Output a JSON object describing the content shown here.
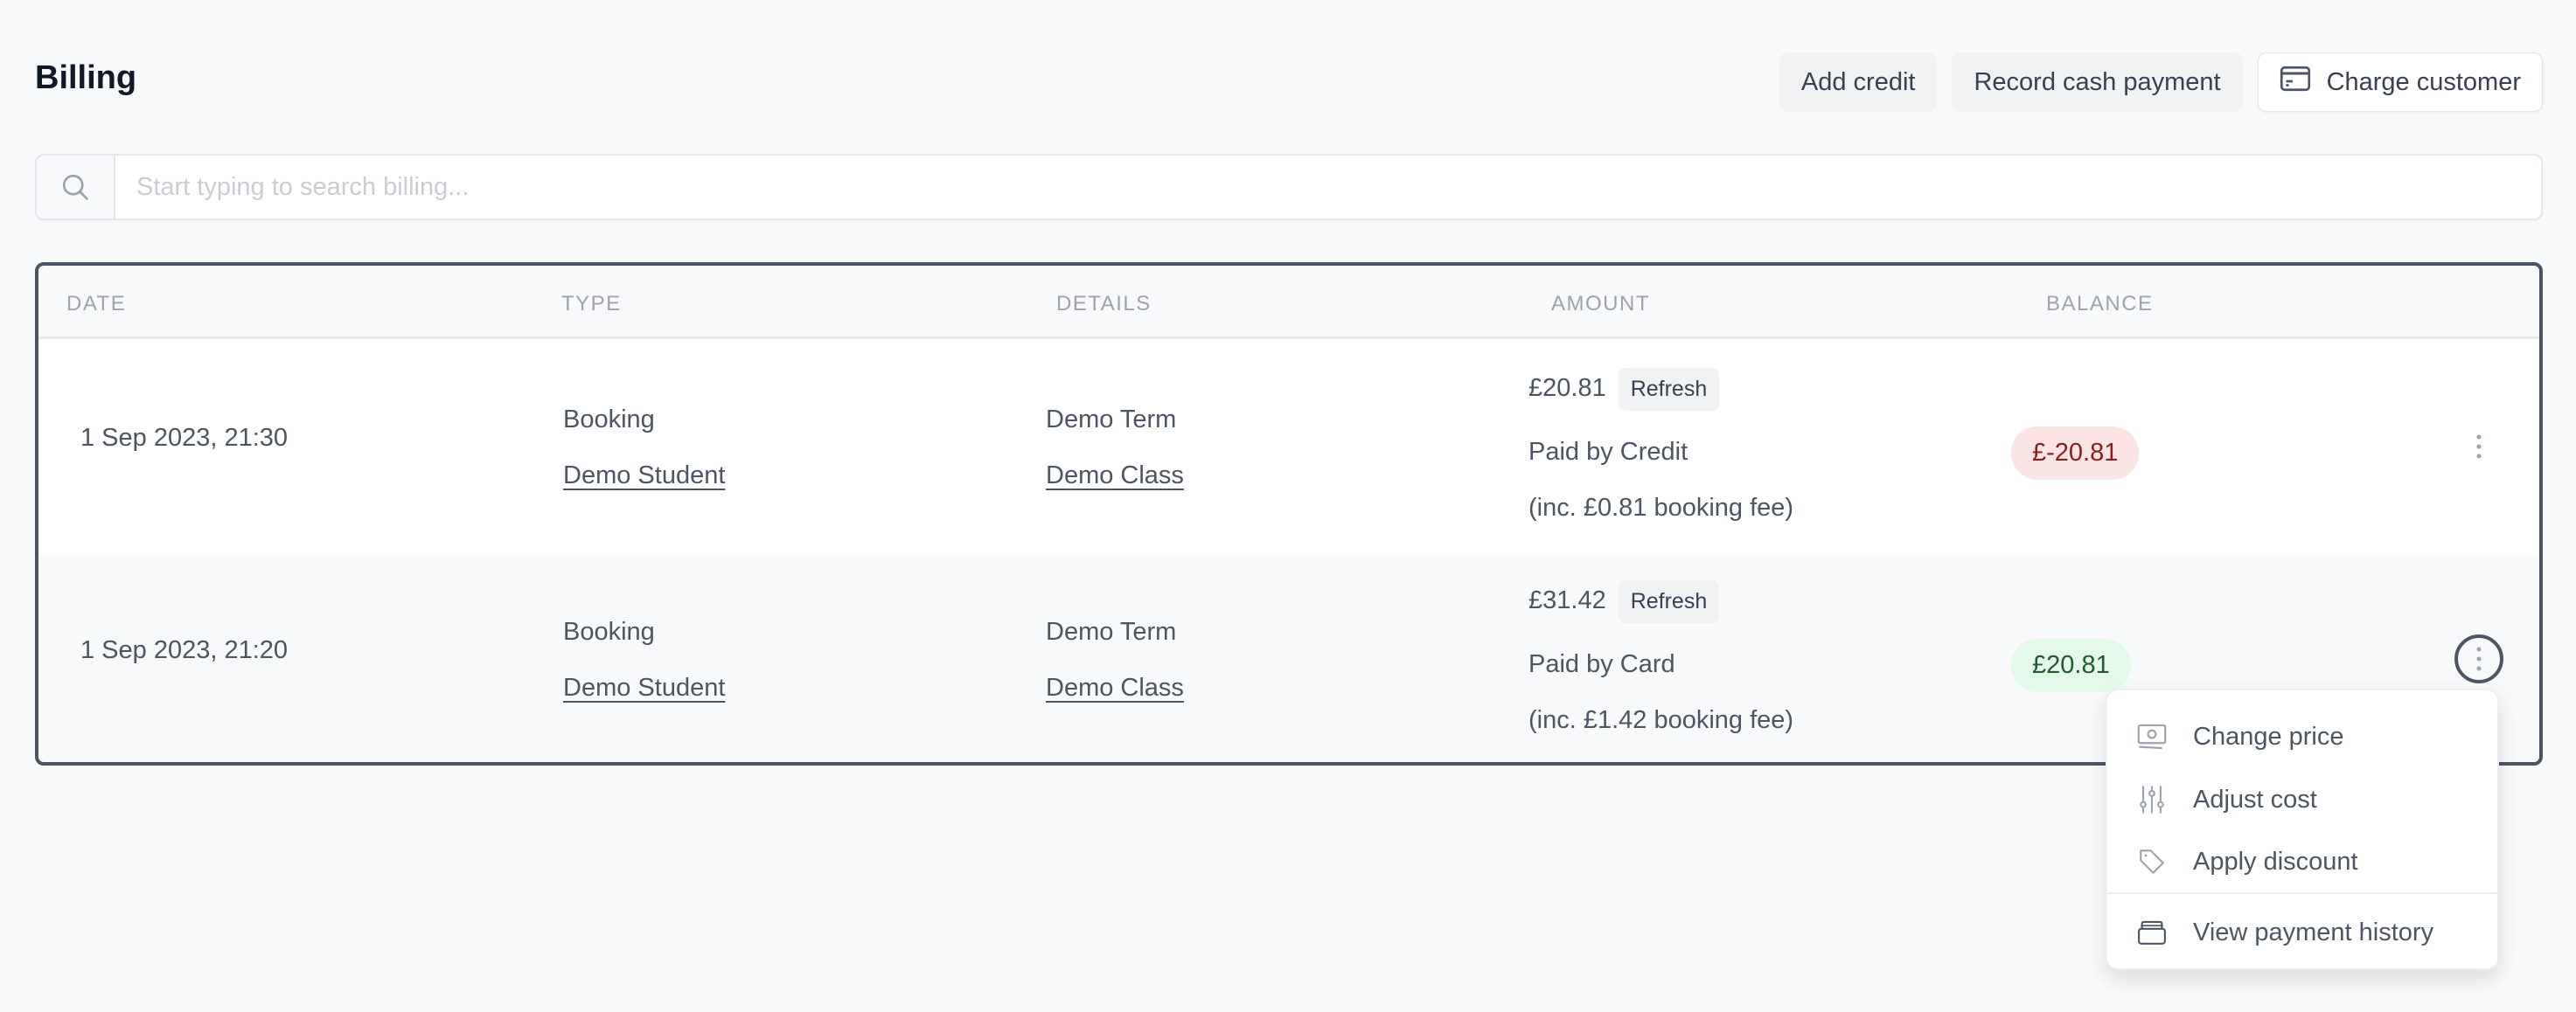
{
  "page": {
    "title": "Billing"
  },
  "toolbar": {
    "add_credit": "Add credit",
    "record_cash": "Record cash payment",
    "charge_customer": "Charge customer",
    "charge_icon": "credit-card-icon"
  },
  "search": {
    "placeholder": "Start typing to search billing...",
    "value": "",
    "icon": "search-icon"
  },
  "table": {
    "headers": [
      "DATE",
      "TYPE",
      "DETAILS",
      "AMOUNT",
      "BALANCE"
    ],
    "rows": [
      {
        "date": "1 Sep 2023, 21:30",
        "type": "Booking",
        "student": "Demo Student",
        "term": "Demo Term",
        "class": "Demo Class",
        "amount": "£20.81",
        "refresh": "Refresh",
        "paid_by": "Paid by Credit",
        "fee": "(inc. £0.81 booking fee)",
        "balance": "£-20.81",
        "balance_status": "negative"
      },
      {
        "date": "1 Sep 2023, 21:20",
        "type": "Booking",
        "student": "Demo Student",
        "term": "Demo Term",
        "class": "Demo Class",
        "amount": "£31.42",
        "refresh": "Refresh",
        "paid_by": "Paid by Card",
        "fee": "(inc. £1.42 booking fee)",
        "balance": "£20.81",
        "balance_status": "positive"
      }
    ]
  },
  "menu": {
    "items": [
      {
        "label": "Change price",
        "icon": "banknote-icon"
      },
      {
        "label": "Adjust cost",
        "icon": "sliders-icon"
      },
      {
        "label": "Apply discount",
        "icon": "tag-icon"
      },
      {
        "label": "View payment history",
        "icon": "archive-box-icon"
      }
    ]
  },
  "colors": {
    "negative_bg": "#fbe4e4",
    "negative_text": "#8b1d1d",
    "positive_bg": "#e3f9e9",
    "positive_text": "#1f5b2c",
    "title": "#111827"
  }
}
